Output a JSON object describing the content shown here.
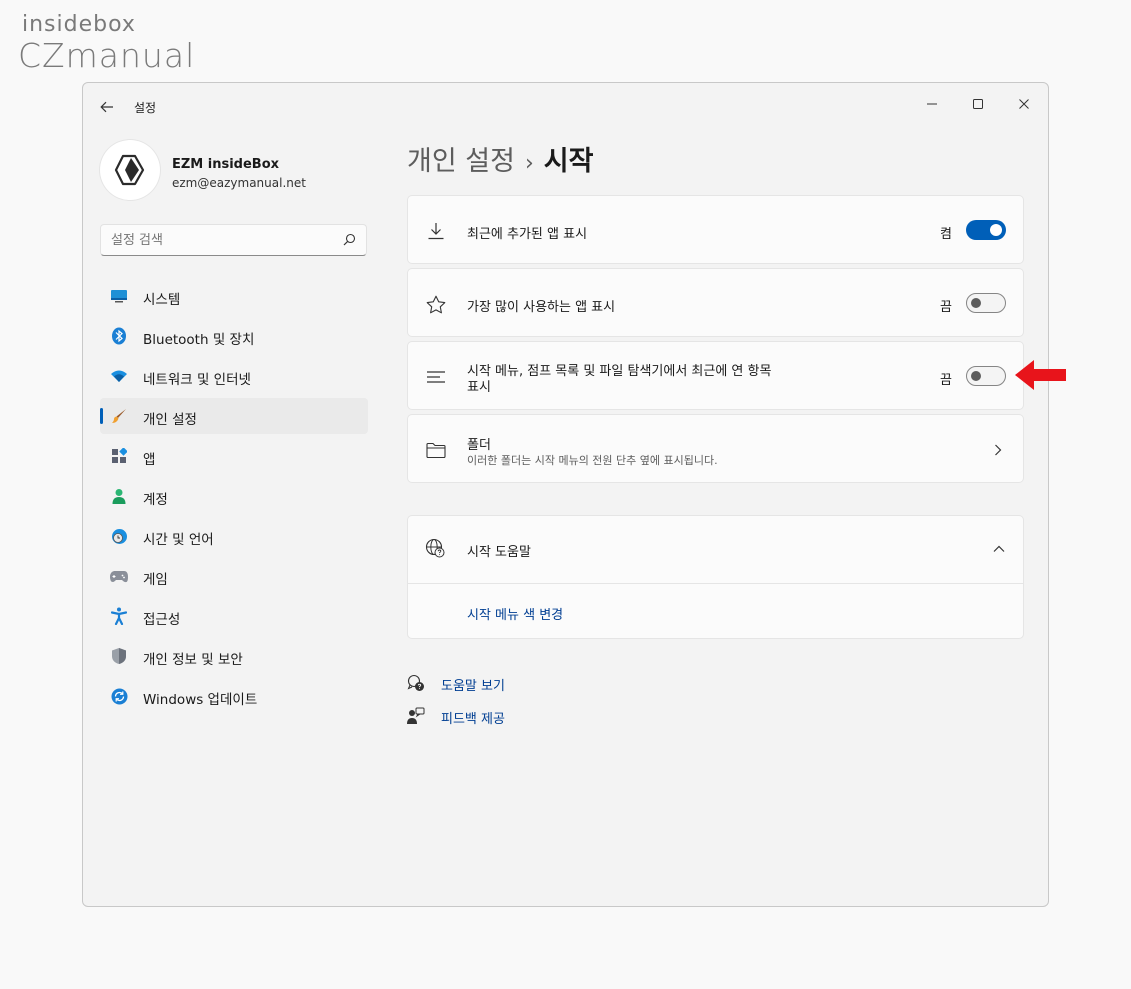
{
  "watermark": {
    "line1": "insidebox",
    "line2": "CZmanual"
  },
  "window": {
    "title": "설정"
  },
  "profile": {
    "name": "EZM insideBox",
    "email": "ezm@eazymanual.net"
  },
  "search": {
    "placeholder": "설정 검색"
  },
  "sidebar": {
    "items": [
      {
        "label": "시스템",
        "icon": "monitor-icon"
      },
      {
        "label": "Bluetooth 및 장치",
        "icon": "bluetooth-icon"
      },
      {
        "label": "네트워크 및 인터넷",
        "icon": "wifi-icon"
      },
      {
        "label": "개인 설정",
        "icon": "brush-icon",
        "active": true
      },
      {
        "label": "앱",
        "icon": "apps-icon"
      },
      {
        "label": "계정",
        "icon": "person-icon"
      },
      {
        "label": "시간 및 언어",
        "icon": "globe-clock-icon"
      },
      {
        "label": "게임",
        "icon": "gamepad-icon"
      },
      {
        "label": "접근성",
        "icon": "accessibility-icon"
      },
      {
        "label": "개인 정보 및 보안",
        "icon": "shield-icon"
      },
      {
        "label": "Windows 업데이트",
        "icon": "update-icon"
      }
    ]
  },
  "breadcrumb": {
    "parent": "개인 설정",
    "separator": "›",
    "current": "시작"
  },
  "settings": {
    "recent_apps": {
      "label": "최근에 추가된 앱 표시",
      "state": "켬",
      "on": true
    },
    "most_used": {
      "label": "가장 많이 사용하는 앱 표시",
      "state": "끔",
      "on": false
    },
    "recent_items": {
      "label_line1": "시작 메뉴, 점프 목록 및 파일 탐색기에서 최근에 연 항목",
      "label_line2": "표시",
      "state": "끔",
      "on": false
    },
    "folders": {
      "label": "폴더",
      "description": "이러한 폴더는 시작 메뉴의 전원 단추 옆에 표시됩니다."
    }
  },
  "help": {
    "title": "시작 도움말",
    "link": "시작 메뉴 색 변경"
  },
  "footer": {
    "get_help": "도움말 보기",
    "feedback": "피드백 제공"
  },
  "colors": {
    "accent": "#005fb8",
    "link": "#003e92",
    "arrow": "#e8141b"
  }
}
